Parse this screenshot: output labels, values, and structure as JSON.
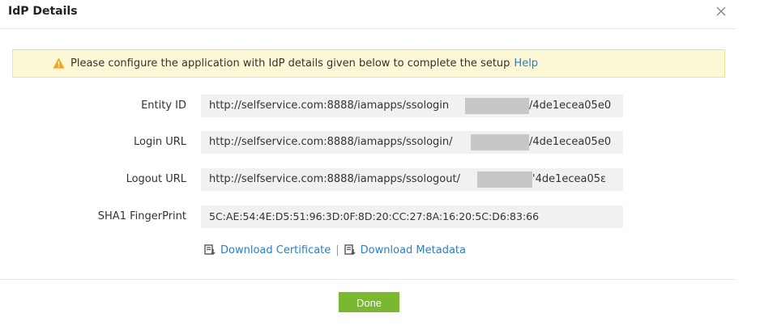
{
  "dialog": {
    "title": "IdP Details",
    "done_label": "Done"
  },
  "banner": {
    "message": "Please configure the application with IdP details given below to complete the setup",
    "help_link": "Help"
  },
  "fields": [
    {
      "label": "Entity ID",
      "prefix": "http://selfservice.com:8888/iamapps/ssologin",
      "suffix": "/4de1ecea05e0"
    },
    {
      "label": "Login URL",
      "prefix": "http://selfservice.com:8888/iamapps/ssologin/",
      "suffix": "/4de1ecea05e0"
    },
    {
      "label": "Logout URL",
      "prefix": "http://selfservice.com:8888/iamapps/ssologout/",
      "suffix": "'4de1ecea05ε"
    },
    {
      "label": "SHA1 FingerPrint",
      "value": "5C:AE:54:4E:D5:51:96:3D:0F:8D:20:CC:27:8A:16:20:5C:D6:83:66"
    }
  ],
  "downloads": {
    "certificate": "Download Certificate",
    "separator": "|",
    "metadata": "Download Metadata"
  },
  "colors": {
    "accent_link": "#2c7fc1",
    "done_button": "#7ab830",
    "banner_bg": "#fcf7d5"
  }
}
